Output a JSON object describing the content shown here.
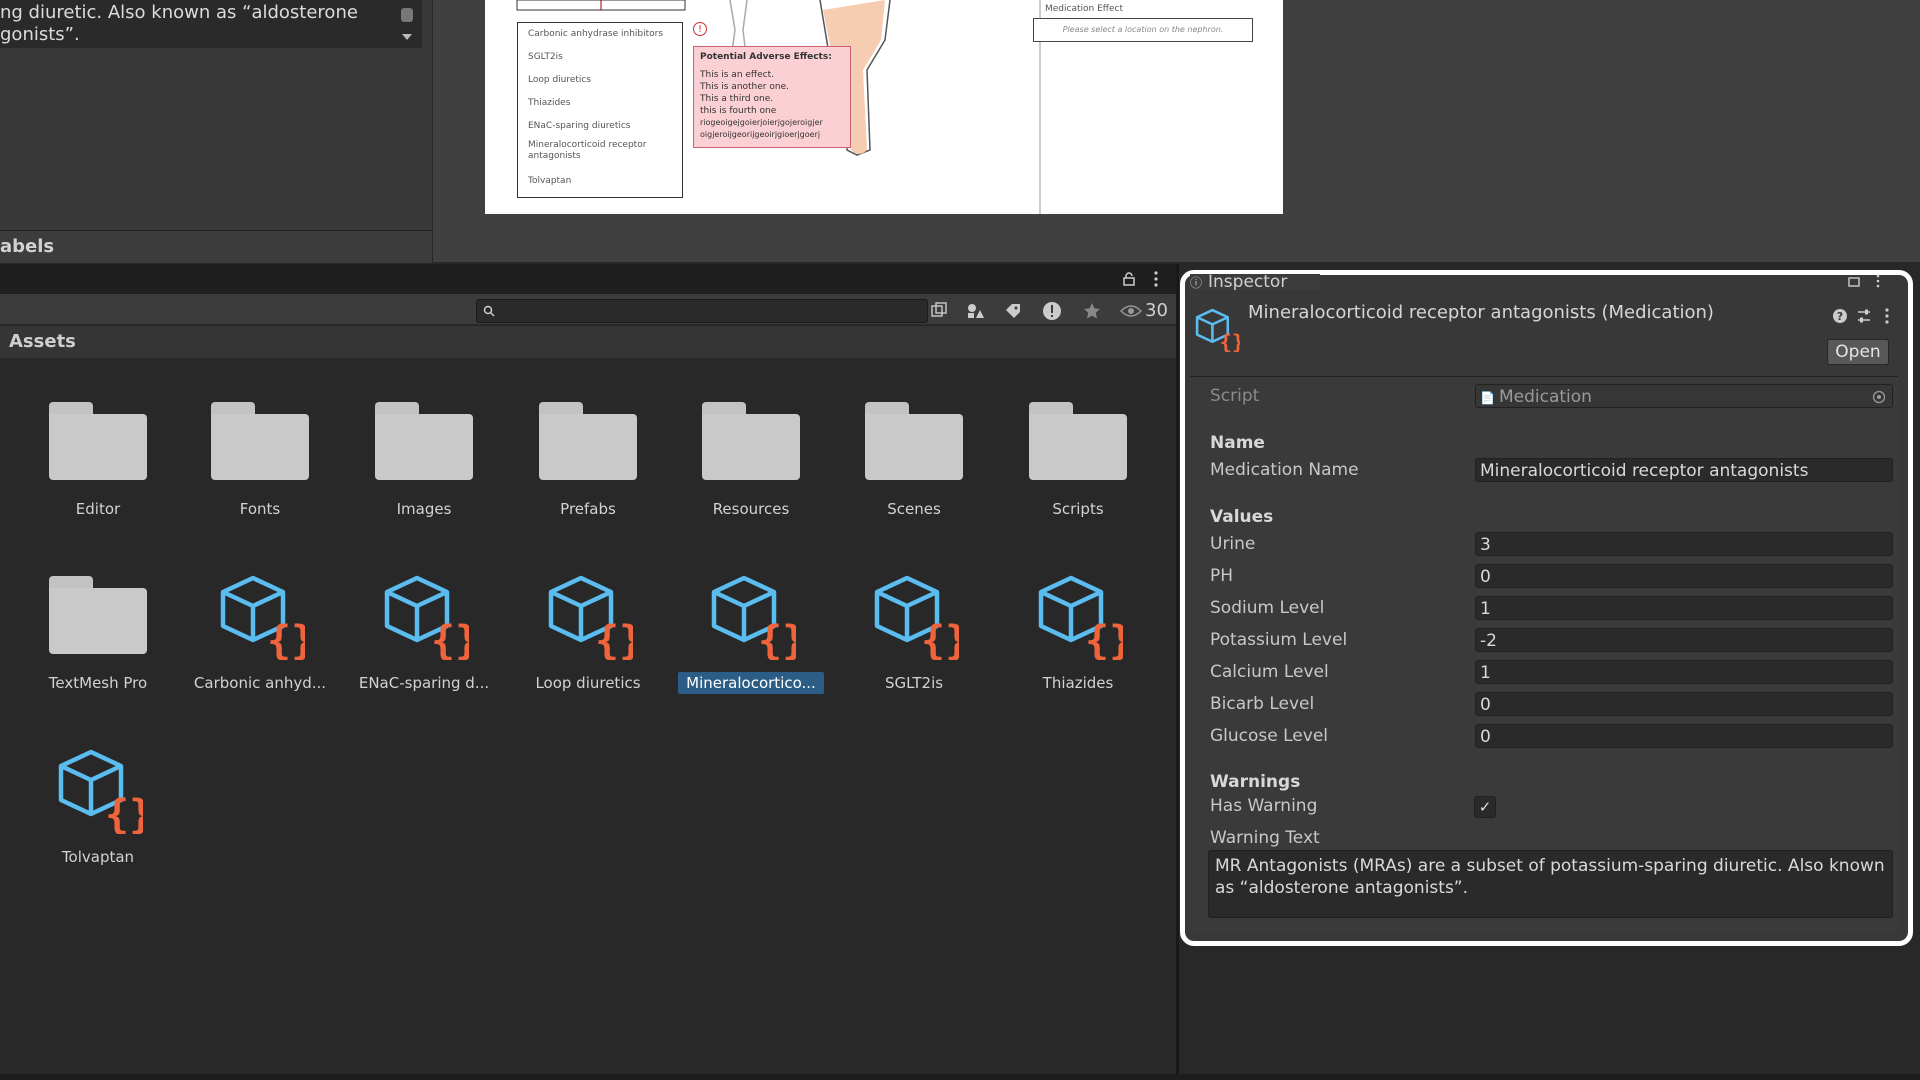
{
  "top_left_panel": {
    "text": "ng diuretic. Also known as “aldosterone\n gonists”.",
    "section_label": "abels"
  },
  "scene": {
    "med_list": [
      "Carbonic anhydrase inhibitors",
      "SGLT2is",
      "Loop diuretics",
      "Thiazides",
      "ENaC-sparing diuretics",
      "Mineralocorticoid receptor antagonists",
      "Tolvaptan"
    ],
    "adverse_title": "Potential Adverse Effects:",
    "adverse_lines": [
      "This is an effect.",
      "This is another one.",
      "This a third one.",
      "this is  fourth one",
      "riogeoigejgoierjoierjgojeroigjer",
      "oigjeroijgeorijgeoirjgioerjgoerj"
    ],
    "effect_label": "Medication Effect",
    "effect_placeholder": "Please select a location on the nephron."
  },
  "project": {
    "search_placeholder": "",
    "visible_count": "30",
    "breadcrumb": "Assets",
    "assets": [
      {
        "name": "Editor",
        "type": "folder"
      },
      {
        "name": "Fonts",
        "type": "folder"
      },
      {
        "name": "Images",
        "type": "folder"
      },
      {
        "name": "Prefabs",
        "type": "folder"
      },
      {
        "name": "Resources",
        "type": "folder"
      },
      {
        "name": "Scenes",
        "type": "folder"
      },
      {
        "name": "Scripts",
        "type": "folder"
      },
      {
        "name": "TextMesh Pro",
        "type": "folder"
      },
      {
        "name": "Carbonic anhyd...",
        "type": "script"
      },
      {
        "name": "ENaC-sparing d...",
        "type": "script"
      },
      {
        "name": "Loop diuretics",
        "type": "script"
      },
      {
        "name": "Mineralocortico...",
        "type": "script",
        "selected": true
      },
      {
        "name": "SGLT2is",
        "type": "script"
      },
      {
        "name": "Thiazides",
        "type": "script"
      },
      {
        "name": "Tolvaptan",
        "type": "script"
      }
    ]
  },
  "inspector": {
    "tab": "Inspector",
    "title": "Mineralocorticoid receptor antagonists (Medication)",
    "open_label": "Open",
    "script_label": "Script",
    "script_value": "Medication",
    "name_header": "Name",
    "medication_name_label": "Medication Name",
    "medication_name_value": "Mineralocorticoid receptor antagonists",
    "values_header": "Values",
    "values": [
      {
        "label": "Urine",
        "value": "3"
      },
      {
        "label": "PH",
        "value": "0"
      },
      {
        "label": "Sodium Level",
        "value": "1"
      },
      {
        "label": "Potassium Level",
        "value": "-2"
      },
      {
        "label": "Calcium Level",
        "value": "1"
      },
      {
        "label": "Bicarb Level",
        "value": "0"
      },
      {
        "label": "Glucose Level",
        "value": "0"
      }
    ],
    "warnings_header": "Warnings",
    "has_warning_label": "Has Warning",
    "has_warning_checked": true,
    "check_mark": "✓",
    "warning_text_label": "Warning Text",
    "warning_text": "MR Antagonists (MRAs) are a subset of potassium-sparing diuretic. Also known as “aldosterone antagonists”."
  },
  "colors": {
    "selection": "#2c5d87",
    "cube_blue": "#5bbcf0",
    "brace_orange": "#f0643c",
    "alert_red": "#d03030"
  }
}
